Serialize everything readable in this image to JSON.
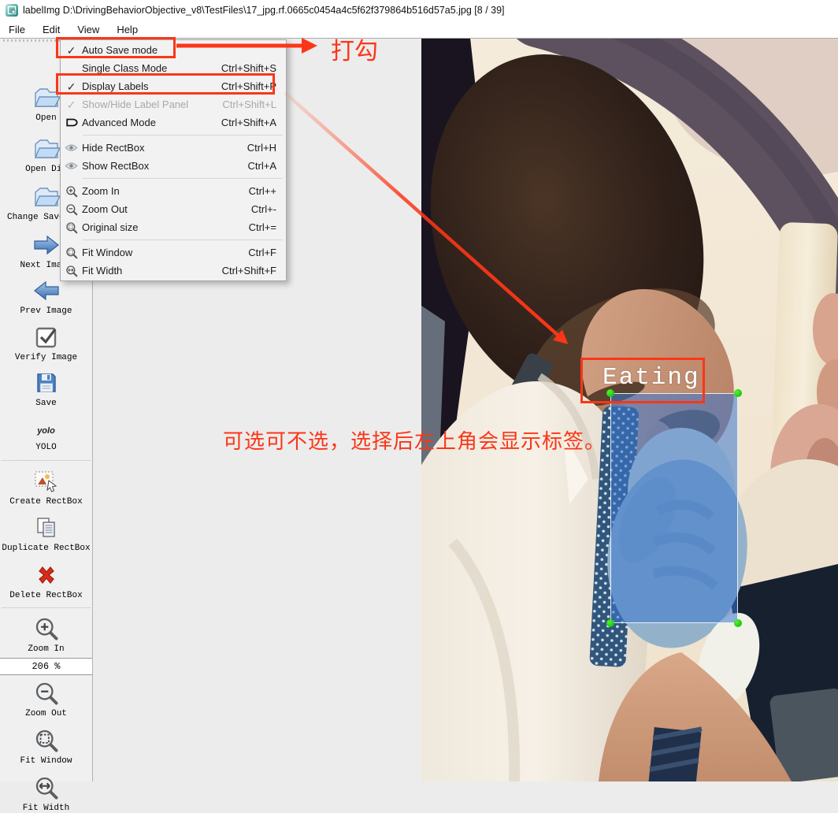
{
  "window": {
    "title": "labelImg D:\\DrivingBehaviorObjective_v8\\TestFiles\\17_jpg.rf.0665c0454a4c5f62f379864b516d57a5.jpg [8 / 39]"
  },
  "menubar": {
    "items": [
      {
        "label": "File"
      },
      {
        "label": "Edit"
      },
      {
        "label": "View"
      },
      {
        "label": "Help"
      }
    ]
  },
  "view_menu": {
    "items": [
      {
        "label": "Auto Save mode",
        "shortcut": "",
        "state": "checked",
        "icon": "checkmark"
      },
      {
        "label": "Single Class Mode",
        "shortcut": "Ctrl+Shift+S",
        "state": "normal",
        "icon": "none"
      },
      {
        "label": "Display Labels",
        "shortcut": "Ctrl+Shift+P",
        "state": "checked",
        "icon": "checkmark"
      },
      {
        "label": "Show/Hide Label Panel",
        "shortcut": "Ctrl+Shift+L",
        "state": "checked-disabled",
        "icon": "checkmark"
      },
      {
        "label": "Advanced Mode",
        "shortcut": "Ctrl+Shift+A",
        "state": "normal",
        "icon": "tag"
      },
      {
        "label": "Hide RectBox",
        "shortcut": "Ctrl+H",
        "state": "normal",
        "icon": "eye"
      },
      {
        "label": "Show RectBox",
        "shortcut": "Ctrl+A",
        "state": "normal",
        "icon": "eye"
      },
      {
        "label": "Zoom In",
        "shortcut": "Ctrl++",
        "state": "normal",
        "icon": "magnifier-plus"
      },
      {
        "label": "Zoom Out",
        "shortcut": "Ctrl+-",
        "state": "normal",
        "icon": "magnifier-minus"
      },
      {
        "label": "Original size",
        "shortcut": "Ctrl+=",
        "state": "normal",
        "icon": "magnifier-original"
      },
      {
        "label": "Fit Window",
        "shortcut": "Ctrl+F",
        "state": "normal",
        "icon": "magnifier-fit"
      },
      {
        "label": "Fit Width",
        "shortcut": "Ctrl+Shift+F",
        "state": "normal",
        "icon": "magnifier-width"
      }
    ]
  },
  "toolbar": {
    "buttons": [
      {
        "label": "Open",
        "icon": "folder"
      },
      {
        "label": "Open Dir",
        "icon": "folder"
      },
      {
        "label": "Change Save Dir",
        "icon": "folder"
      },
      {
        "label": "Next Image",
        "icon": "arrow-right"
      },
      {
        "label": "Prev Image",
        "icon": "arrow-left"
      },
      {
        "label": "Verify Image",
        "icon": "check-square"
      },
      {
        "label": "Save",
        "icon": "floppy"
      },
      {
        "label": "YOLO",
        "icon": "yolo-text"
      },
      {
        "label": "Create RectBox",
        "icon": "create-rectbox"
      },
      {
        "label": "Duplicate RectBox",
        "icon": "duplicate"
      },
      {
        "label": "Delete RectBox",
        "icon": "red-cross"
      },
      {
        "label": "Zoom In",
        "icon": "magnifier-plus"
      },
      {
        "label": "Zoom Out",
        "icon": "magnifier-minus"
      },
      {
        "label": "Fit Window",
        "icon": "magnifier-fit"
      },
      {
        "label": "Fit Width",
        "icon": "magnifier-width"
      }
    ],
    "yolo_icon_text": "yolo"
  },
  "zoom_control": {
    "value": "206 %"
  },
  "annotation": {
    "box_label": "Eating"
  },
  "tutorial_notes": {
    "note_check": "打勾",
    "note_optional": "可选可不选，选择后左上角会显示标签。"
  },
  "colors": {
    "annotation_red": "#fb3618",
    "bbox_fill_blue": "#3a76cd",
    "handle_green": "#17c90a",
    "canvas_gray": "#ececec"
  }
}
